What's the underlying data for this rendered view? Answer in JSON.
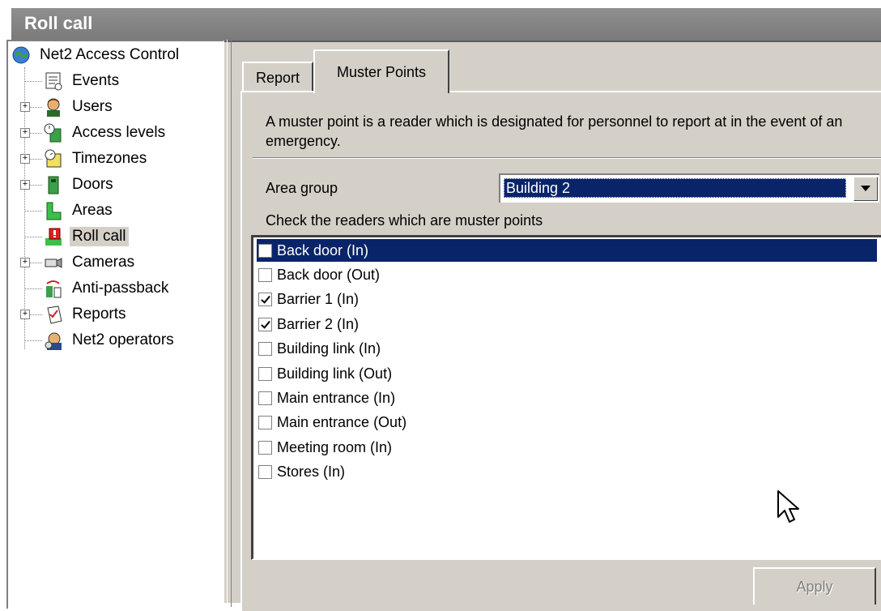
{
  "window": {
    "title": "Roll call"
  },
  "tree": {
    "root": {
      "label": "Net2 Access Control",
      "icon": "globe-icon"
    },
    "items": [
      {
        "label": "Events",
        "icon": "events-icon",
        "expandable": false
      },
      {
        "label": "Users",
        "icon": "users-icon",
        "expandable": true
      },
      {
        "label": "Access levels",
        "icon": "access-levels-icon",
        "expandable": true
      },
      {
        "label": "Timezones",
        "icon": "clock-icon",
        "expandable": true
      },
      {
        "label": "Doors",
        "icon": "door-icon",
        "expandable": true
      },
      {
        "label": "Areas",
        "icon": "areas-icon",
        "expandable": false
      },
      {
        "label": "Roll call",
        "icon": "roll-call-icon",
        "expandable": false,
        "selected": true
      },
      {
        "label": "Cameras",
        "icon": "camera-icon",
        "expandable": true
      },
      {
        "label": "Anti-passback",
        "icon": "anti-passback-icon",
        "expandable": false
      },
      {
        "label": "Reports",
        "icon": "reports-icon",
        "expandable": true
      },
      {
        "label": "Net2 operators",
        "icon": "operators-icon",
        "expandable": false
      }
    ]
  },
  "tabs": [
    {
      "label": "Report",
      "active": false
    },
    {
      "label": "Muster Points",
      "active": true
    }
  ],
  "muster": {
    "description": "A muster point is a reader which is designated for personnel to report at in the event of an emergency.",
    "area_group_label": "Area group",
    "area_group_value": "Building 2",
    "check_label": "Check the readers which are muster points",
    "readers": [
      {
        "label": "Back door (In)",
        "checked": false,
        "selected": true
      },
      {
        "label": "Back door (Out)",
        "checked": false
      },
      {
        "label": "Barrier 1 (In)",
        "checked": true
      },
      {
        "label": "Barrier 2 (In)",
        "checked": true
      },
      {
        "label": "Building link (In)",
        "checked": false
      },
      {
        "label": "Building link (Out)",
        "checked": false
      },
      {
        "label": "Main entrance (In)",
        "checked": false
      },
      {
        "label": "Main entrance (Out)",
        "checked": false
      },
      {
        "label": "Meeting room (In)",
        "checked": false
      },
      {
        "label": "Stores (In)",
        "checked": false
      }
    ],
    "apply_label": "Apply"
  },
  "colors": {
    "selection": "#0a246a",
    "face": "#d4d0c8",
    "titlebar": "#808080"
  }
}
